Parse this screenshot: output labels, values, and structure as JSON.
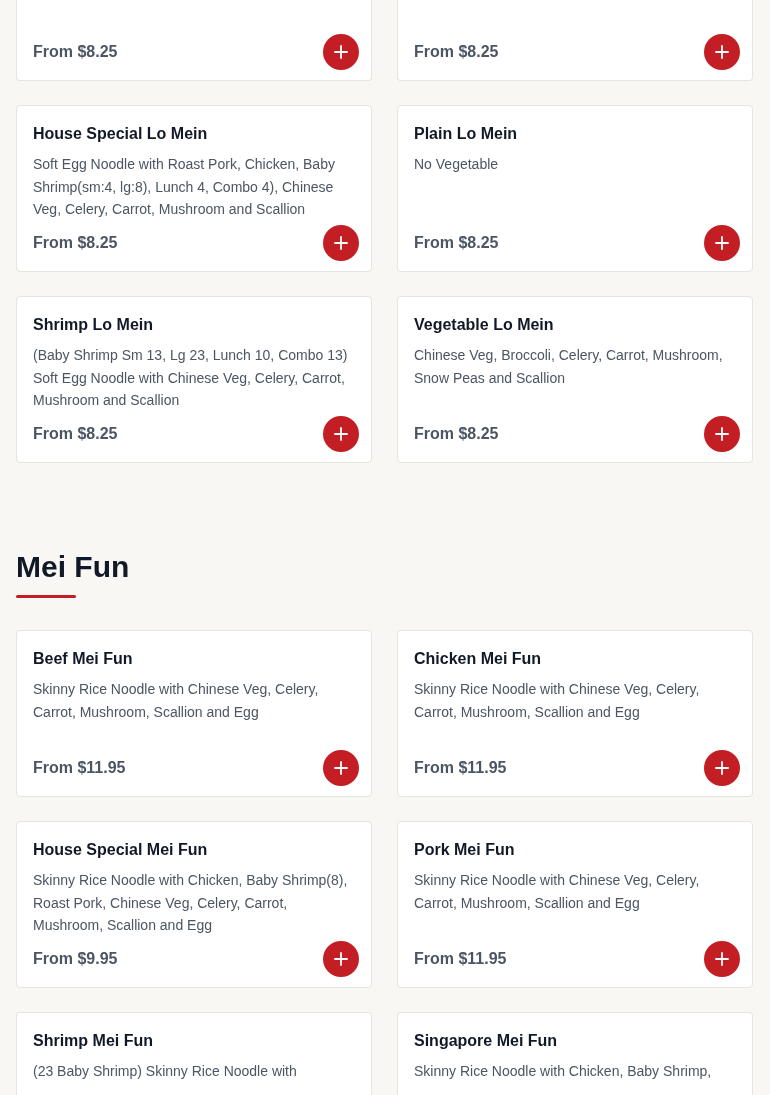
{
  "sections": [
    {
      "items": [
        {
          "price": "From $8.25"
        },
        {
          "price": "From $8.25"
        },
        {
          "name": "House Special Lo Mein",
          "description": "Soft Egg Noodle with Roast Pork, Chicken, Baby Shrimp(sm:4, lg:8), Lunch 4, Combo 4), Chinese Veg, Celery, Carrot, Mushroom and Scallion",
          "price": "From $8.25"
        },
        {
          "name": "Plain Lo Mein",
          "description": "No Vegetable",
          "price": "From $8.25"
        },
        {
          "name": "Shrimp Lo Mein",
          "description": "(Baby Shrimp Sm 13, Lg 23, Lunch 10, Combo 13) Soft Egg Noodle with Chinese Veg, Celery, Carrot, Mushroom and Scallion",
          "price": "From $8.25"
        },
        {
          "name": "Vegetable Lo Mein",
          "description": "Chinese Veg, Broccoli, Celery, Carrot, Mushroom, Snow Peas and Scallion",
          "price": "From $8.25"
        }
      ]
    },
    {
      "title": "Mei Fun",
      "items": [
        {
          "name": "Beef Mei Fun",
          "description": "Skinny Rice Noodle with Chinese Veg, Celery, Carrot, Mushroom, Scallion and Egg",
          "price": "From $11.95"
        },
        {
          "name": "Chicken Mei Fun",
          "description": "Skinny Rice Noodle with Chinese Veg, Celery, Carrot, Mushroom, Scallion and Egg",
          "price": "From $11.95"
        },
        {
          "name": "House Special Mei Fun",
          "description": "Skinny Rice Noodle with Chicken, Baby Shrimp(8), Roast Pork, Chinese Veg, Celery, Carrot, Mushroom, Scallion and Egg",
          "price": "From $9.95"
        },
        {
          "name": "Pork Mei Fun",
          "description": "Skinny Rice Noodle with Chinese Veg, Celery, Carrot, Mushroom, Scallion and Egg",
          "price": "From $11.95"
        },
        {
          "name": "Shrimp Mei Fun",
          "description": "(23 Baby Shrimp) Skinny Rice Noodle with"
        },
        {
          "name": "Singapore Mei Fun",
          "description": "Skinny Rice Noodle with Chicken, Baby Shrimp,"
        }
      ]
    }
  ]
}
